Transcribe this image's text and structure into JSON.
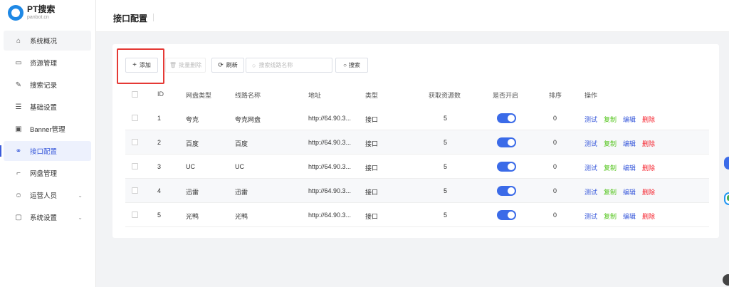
{
  "brand": {
    "name": "PT搜索",
    "domain": "panbot.cn",
    "logo_text": "CRM"
  },
  "menu": [
    {
      "label": "系统概况",
      "icon": "home-icon"
    },
    {
      "label": "资源管理",
      "icon": "folder-icon"
    },
    {
      "label": "搜索记录",
      "icon": "pen-icon"
    },
    {
      "label": "基础设置",
      "icon": "sliders-icon"
    },
    {
      "label": "Banner管理",
      "icon": "image-icon"
    },
    {
      "label": "接口配置",
      "icon": "link-icon",
      "active": true
    },
    {
      "label": "网盘管理",
      "icon": "crop-icon"
    },
    {
      "label": "运营人员",
      "icon": "user-icon",
      "expandable": true
    },
    {
      "label": "系统设置",
      "icon": "monitor-icon",
      "expandable": true
    }
  ],
  "page": {
    "title": "接口配置"
  },
  "toolbar": {
    "add_label": "添加",
    "batch_delete_label": "批量删除",
    "refresh_label": "刷新",
    "search_placeholder": "搜索线路名称",
    "search_label": "搜索"
  },
  "table": {
    "headers": [
      "ID",
      "网盘类型",
      "线路名称",
      "地址",
      "类型",
      "获取资源数",
      "是否开启",
      "排序",
      "操作"
    ],
    "rows": [
      {
        "id": "1",
        "disk": "夸克",
        "name": "夸克网盘",
        "addr": "http://64.90.3...",
        "type": "接口",
        "count": "5",
        "enabled": true,
        "sort": "0"
      },
      {
        "id": "2",
        "disk": "百度",
        "name": "百度",
        "addr": "http://64.90.3...",
        "type": "接口",
        "count": "5",
        "enabled": true,
        "sort": "0"
      },
      {
        "id": "3",
        "disk": "UC",
        "name": "UC",
        "addr": "http://64.90.3...",
        "type": "接口",
        "count": "5",
        "enabled": true,
        "sort": "0"
      },
      {
        "id": "4",
        "disk": "迅雷",
        "name": "迅雷",
        "addr": "http://64.90.3...",
        "type": "接口",
        "count": "5",
        "enabled": true,
        "sort": "0"
      },
      {
        "id": "5",
        "disk": "光鸭",
        "name": "光鸭",
        "addr": "http://64.90.3...",
        "type": "接口",
        "count": "5",
        "enabled": true,
        "sort": "0"
      }
    ],
    "actions": {
      "test": "测试",
      "copy": "复制",
      "edit": "编辑",
      "delete": "删除"
    }
  },
  "colors": {
    "accent": "#3b5bdb",
    "toggle": "#3b6be8",
    "copy": "#52c41a",
    "delete": "#f5222d",
    "highlight": "#e53935"
  }
}
